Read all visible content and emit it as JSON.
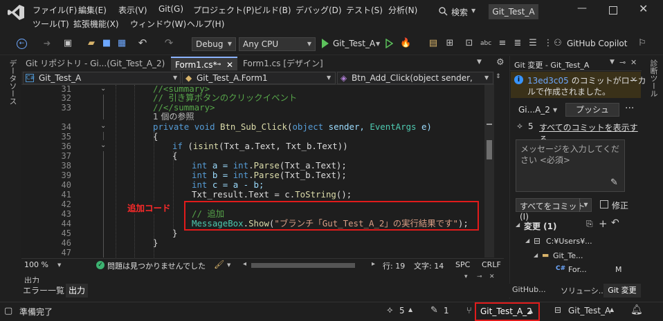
{
  "menu": [
    "ファイル(F)",
    "編集(E)",
    "表示(V)",
    "Git(G)",
    "プロジェクト(P)",
    "ビルド(B)",
    "デバッグ(D)",
    "テスト(S)",
    "分析(N)",
    "ツール(T)",
    "拡張機能(X)",
    "ウィンドウ(W)",
    "ヘルプ(H)"
  ],
  "search_label": "検索",
  "solution_title": "Git_Test_A",
  "toolbar": {
    "config": "Debug",
    "platform": "Any CPU",
    "run_target": "Git_Test_A",
    "copilot": "GitHub Copilot"
  },
  "left_vtab": "データソース",
  "right_vtab": "診断ツール",
  "doc_tabs": [
    "Git リポジトリ - Gi...(Git_Test_A_2)",
    "Form1.cs*",
    "Form1.cs [デザイン]"
  ],
  "nav": {
    "project": "Git_Test_A",
    "class": "Git_Test_A.Form1",
    "member": "Btn_Add_Click(object sender, EventA"
  },
  "line_numbers": [
    "31",
    "32",
    "33",
    "34",
    "35",
    "36",
    "37",
    "38",
    "39",
    "40",
    "41",
    "42",
    "43",
    "44",
    "45",
    "46",
    "47"
  ],
  "code": {
    "l31": "//<summary>",
    "l32": "// 引き算ボタンのクリックイベント",
    "l33": "//</summary>",
    "ref": "1 個の参照",
    "l34a": "private",
    "l34b": "void",
    "l34c": "Btn_Sub_Click",
    "l34d": "(",
    "l34e": "object",
    "l34f": " sender, ",
    "l34g": "EventArgs",
    "l34h": " e)",
    "l35": "{",
    "l36a": "if",
    "l36b": " (",
    "l36c": "isint",
    "l36d": "(Txt_a.Text, Txt_b.Text))",
    "l37": "{",
    "l38a": "int",
    "l38b": " a = ",
    "l38c": "int",
    "l38d": ".",
    "l38e": "Parse",
    "l38f": "(Txt_a.Text);",
    "l39a": "int",
    "l39b": " b = ",
    "l39c": "int",
    "l39d": ".",
    "l39e": "Parse",
    "l39f": "(Txt_b.Text);",
    "l40a": "int",
    "l40b": " c = a - b;",
    "l41a": "Txt_result.Text = c.",
    "l41b": "ToString",
    "l41c": "();",
    "l43": "// 追加",
    "l44a": "MessageBox",
    "l44b": ".",
    "l44c": "Show",
    "l44d": "(",
    "l44e": "\"ブランチ「Gut_Test_A_2」の実行結果です\"",
    "l44f": ");",
    "l45": "}",
    "l46": "}"
  },
  "annotation": "追加コード",
  "editor_status": {
    "zoom": "100 %",
    "issues": "問題は見つかりませんでした",
    "line": "行: 19",
    "col": "文字: 14",
    "spc": "SPC",
    "crlf": "CRLF"
  },
  "output_panel": {
    "title": "出力",
    "tabs": [
      "エラー一覧",
      "出力"
    ]
  },
  "git_panel": {
    "title": "Git 変更 - Git_Test_A",
    "info_hash": "13ed3c05",
    "info_text1": " のコミット",
    "info_text2": "がローカ",
    "info_text3": "ルで作成されました。",
    "branch": "Gi...A_2",
    "push": "プッシュ",
    "commits_count": "5",
    "view_all": "すべてのコミットを表示する",
    "message_placeholder": "メッセージを入力してください <必須>",
    "commit_all": "すべてをコミット(I)",
    "amend": "修正",
    "changes": "変更 (1)",
    "tree": [
      "C:¥Users¥...",
      "Git_Te...",
      "For..."
    ],
    "tree_status": "M",
    "bottom_tabs": [
      "GitHub...",
      "ソリューシ...",
      "Git 変更"
    ]
  },
  "status": {
    "ready": "準備完了",
    "commits_up": "5",
    "pending": "1",
    "branch": "Git_Test_A_2",
    "repo": "Git_Test_A"
  }
}
